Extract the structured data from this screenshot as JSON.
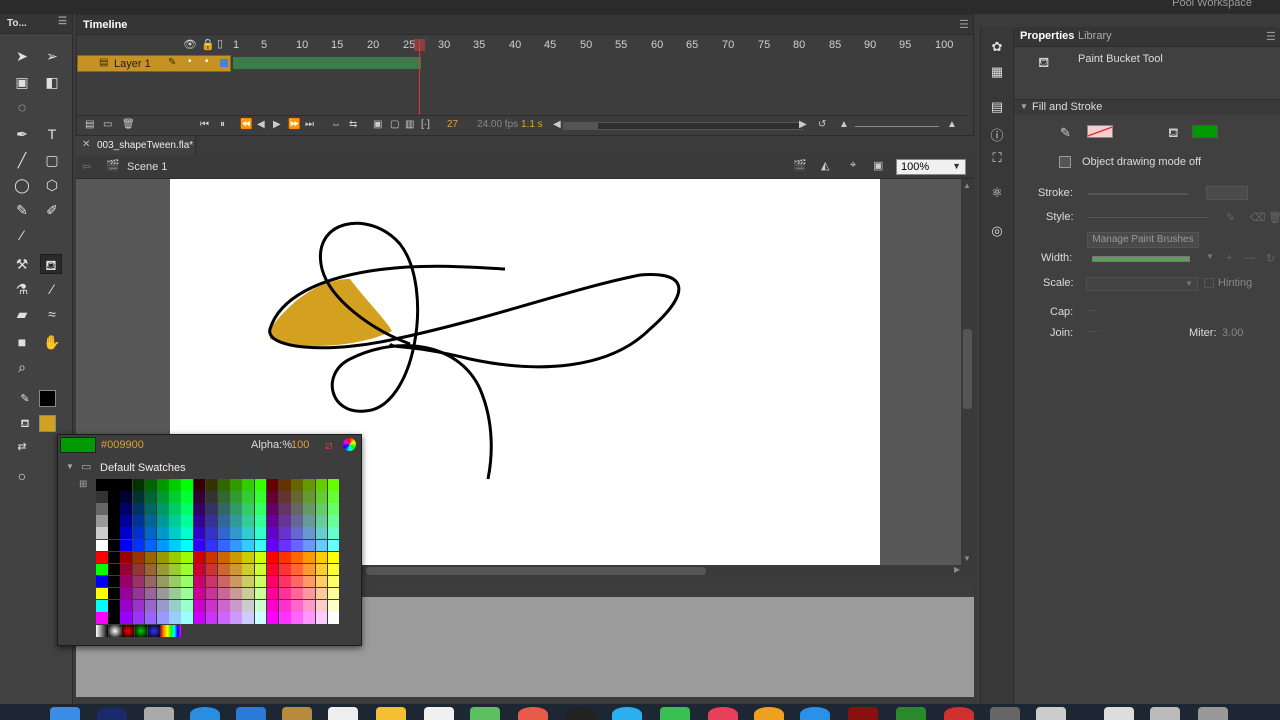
{
  "window": {
    "workspace": "Pool Workspace"
  },
  "tools": {
    "title": "To..."
  },
  "timeline": {
    "title": "Timeline",
    "frame_numbers": [
      "1",
      "5",
      "10",
      "15",
      "20",
      "25",
      "30",
      "35",
      "40",
      "45",
      "50",
      "55",
      "60",
      "65",
      "70",
      "75",
      "80",
      "85",
      "90",
      "95",
      "100"
    ],
    "layer_name": "Layer 1",
    "current_frame": "27",
    "fps": "24.00 fps",
    "time": "1.1 s"
  },
  "document": {
    "tab_label": "003_shapeTween.fla*",
    "scene": "Scene 1",
    "zoom": "100%"
  },
  "picker": {
    "hex": "#009900",
    "alpha_label": "Alpha:%",
    "alpha_value": "100",
    "folder": "Default Swatches",
    "current_color": "#009900"
  },
  "properties": {
    "tab_properties": "Properties",
    "tab_library": "Library",
    "tool_name": "Paint Bucket Tool",
    "section_fill_stroke": "Fill and Stroke",
    "object_drawing": "Object drawing mode off",
    "stroke_label": "Stroke:",
    "style_label": "Style:",
    "manage_brushes": "Manage Paint Brushes",
    "width_label": "Width:",
    "scale_label": "Scale:",
    "hinting": "Hinting",
    "cap_label": "Cap:",
    "join_label": "Join:",
    "miter_label": "Miter:",
    "miter_value": "3.00",
    "fill_color": "#009900"
  },
  "colors": {
    "shape_fill": "#d4a020",
    "layer_highlight": "#c69226",
    "playhead": "#d43a3a",
    "accent": "#e0a030"
  }
}
